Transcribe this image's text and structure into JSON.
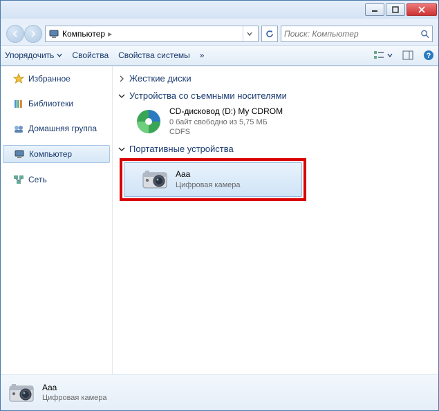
{
  "address": {
    "root_label": "Компьютер"
  },
  "search": {
    "placeholder": "Поиск: Компьютер"
  },
  "toolbar": {
    "organize": "Упорядочить",
    "properties": "Свойства",
    "system_properties": "Свойства системы",
    "more": "»"
  },
  "sidebar": {
    "favorites": "Избранное",
    "libraries": "Библиотеки",
    "homegroup": "Домашняя группа",
    "computer": "Компьютер",
    "network": "Сеть"
  },
  "content": {
    "hard_drives_header": "Жесткие диски",
    "removable_header": "Устройства со съемными носителями",
    "cd_drive": {
      "title": "CD-дисковод (D:) My CDROM",
      "line1": "0 байт свободно из 5,75 МБ",
      "line2": "CDFS"
    },
    "portable_header": "Портативные устройства",
    "camera": {
      "title": "Aaa",
      "subtitle": "Цифровая камера"
    }
  },
  "details": {
    "title": "Aaa",
    "subtitle": "Цифровая камера"
  }
}
